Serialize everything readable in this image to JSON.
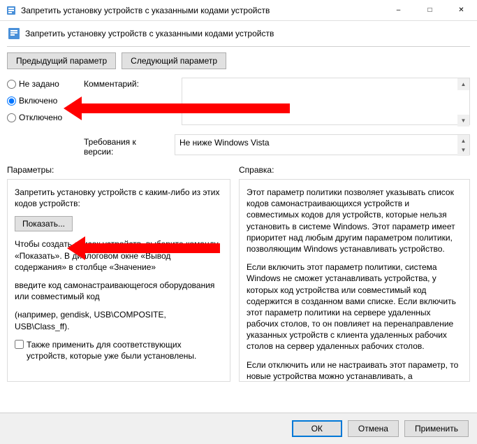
{
  "window": {
    "title": "Запретить установку устройств с указанными кодами устройств"
  },
  "header": {
    "title": "Запретить установку устройств с указанными кодами устройств"
  },
  "nav": {
    "prev": "Предыдущий параметр",
    "next": "Следующий параметр"
  },
  "state": {
    "not_configured": "Не задано",
    "enabled": "Включено",
    "disabled": "Отключено",
    "selected": "enabled"
  },
  "comment": {
    "label": "Комментарий:",
    "value": ""
  },
  "requirements": {
    "label": "Требования к версии:",
    "value": "Не ниже Windows Vista"
  },
  "panels": {
    "options_label": "Параметры:",
    "help_label": "Справка:"
  },
  "options": {
    "title": "Запретить установку устройств с каким-либо из этих кодов устройств:",
    "show_button": "Показать...",
    "instructions": "Чтобы создать список устройств, выберите команду «Показать». В диалоговом окне «Вывод содержания» в столбце «Значение»",
    "hint": "введите код самонастраивающегося оборудования или совместимый код",
    "example": "(например, gendisk, USB\\COMPOSITE, USB\\Class_ff).",
    "also_apply": "Также применить для соответствующих устройств, которые уже были установлены."
  },
  "help": {
    "p1": "Этот параметр политики позволяет указывать список кодов самонастраивающихся устройств и совместимых кодов для устройств, которые нельзя установить в системе Windows. Этот параметр имеет приоритет над любым другим параметром политики, позволяющим Windows устанавливать устройство.",
    "p2": "Если включить этот параметр политики, система Windows не сможет устанавливать устройства, у которых код устройства или совместимый код содержится в созданном вами списке. Если включить этот параметр политики на сервере удаленных рабочих столов, то он повлияет на перенаправление указанных устройств с клиента удаленных рабочих столов на сервер удаленных рабочих столов.",
    "p3": "Если отключить или не настраивать этот параметр, то новые устройства можно устанавливать, а существующие обновлять, насколько это разрешено или запрещено другими параметрами политики."
  },
  "buttons": {
    "ok": "ОК",
    "cancel": "Отмена",
    "apply": "Применить"
  }
}
